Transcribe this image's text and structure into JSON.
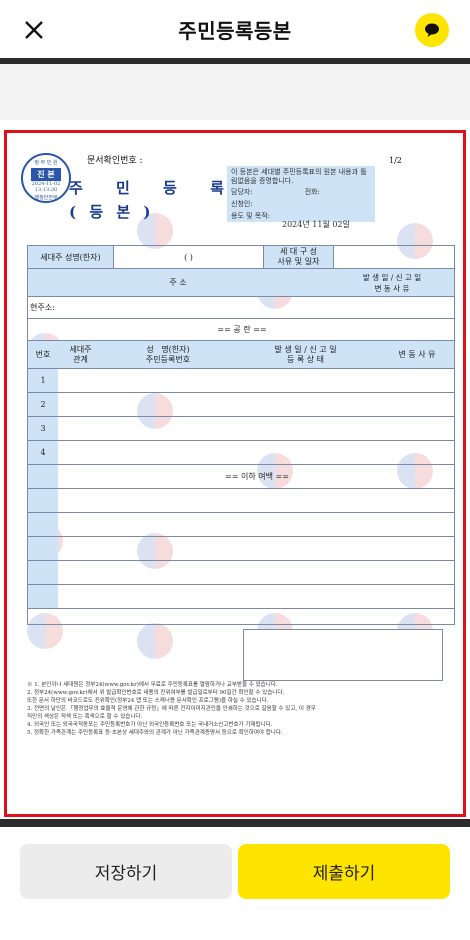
{
  "header": {
    "title": "주민등록등본",
    "close_icon": "close-icon",
    "talk_icon": "chat-bubble-icon"
  },
  "document": {
    "doc_confirm_label": "문서확인번호 :",
    "page_indicator": "1/2",
    "title_line1": "주 민 등 록 표",
    "title_line2": "( 등    본 )",
    "stamp": {
      "top_text": "정 부 민 원",
      "center_text": "진 본",
      "date": "2024-11-02",
      "time": "13:13:30",
      "bottom_text": "행정안전부"
    },
    "info_text": "이 등본은 세대별 주민등록표의 원본 내용과 틀림없음을 증명합니다.",
    "info_fields": {
      "manager": "담당자:",
      "phone": "전화:",
      "applicant": "신청인:",
      "purpose": "용도 및 목적:"
    },
    "issue_date": "2024년 11월 02일",
    "table": {
      "head_name": "세대주 성명(한자)",
      "head_paren": "(            )",
      "head_reason": "세 대 구 성\n사유 및 일자",
      "addr_label": "주                    소",
      "addr_date": "발 생 일 / 신 고 일",
      "addr_change": "변    동    사    유",
      "current_addr": "현주소:",
      "blank_mark": "==  공   란  ==",
      "col_no": "번호",
      "col_rel": "세대주\n관계",
      "col_name": "성   명(한자)\n주민등록번호",
      "col_date": "발 생 일 / 신 고 일\n등 록 상 태",
      "col_reason": "변 동 사 유",
      "row_numbers": [
        "1",
        "2",
        "3",
        "4"
      ],
      "end_mark": "== 이하 여백 =="
    },
    "footnotes": [
      "※  1. 본인이나 세대원은 정부24(www.gov.kr)에서 무료로 주민등록표를 열람하거나 교부받을 수 있습니다.",
      "    2. 정부24(www.gov.kr)에서 위 발급확인번호로 내용의 진위여부를 발급일로부터 90일간 확인할 수 있습니다.",
      "       또한 문서 하단의 바코드로도 진위확인(정부24 앱 또는 스캐너용 문서확인 프로그램)을 하실 수 있습니다.",
      "    3. 전면의 날인은 「행정업무의 효율적 운영에 관한 규정」에 따른 전자이미지관인을 인쇄하는 것으로 갈음할 수 있고, 이 경우",
      "       직인의 색상은 적색 또는 흑색으로 할 수 있습니다.",
      "    4. 외국인 또는 외국국적동포는 주민등록번호가 아닌 외국인등록번호 또는 국내거소신고번호가 기재됩니다.",
      "    5. 정확한 가족관계는 주민등록표 등·초본상 세대주와의 관계가 아닌 가족관계증명서 등으로 확인하여야 합니다."
    ]
  },
  "actions": {
    "save_label": "저장하기",
    "submit_label": "제출하기"
  },
  "colors": {
    "highlight_border": "#e0101a",
    "accent_yellow": "#FEE500",
    "table_blue": "#cfe3f6"
  }
}
